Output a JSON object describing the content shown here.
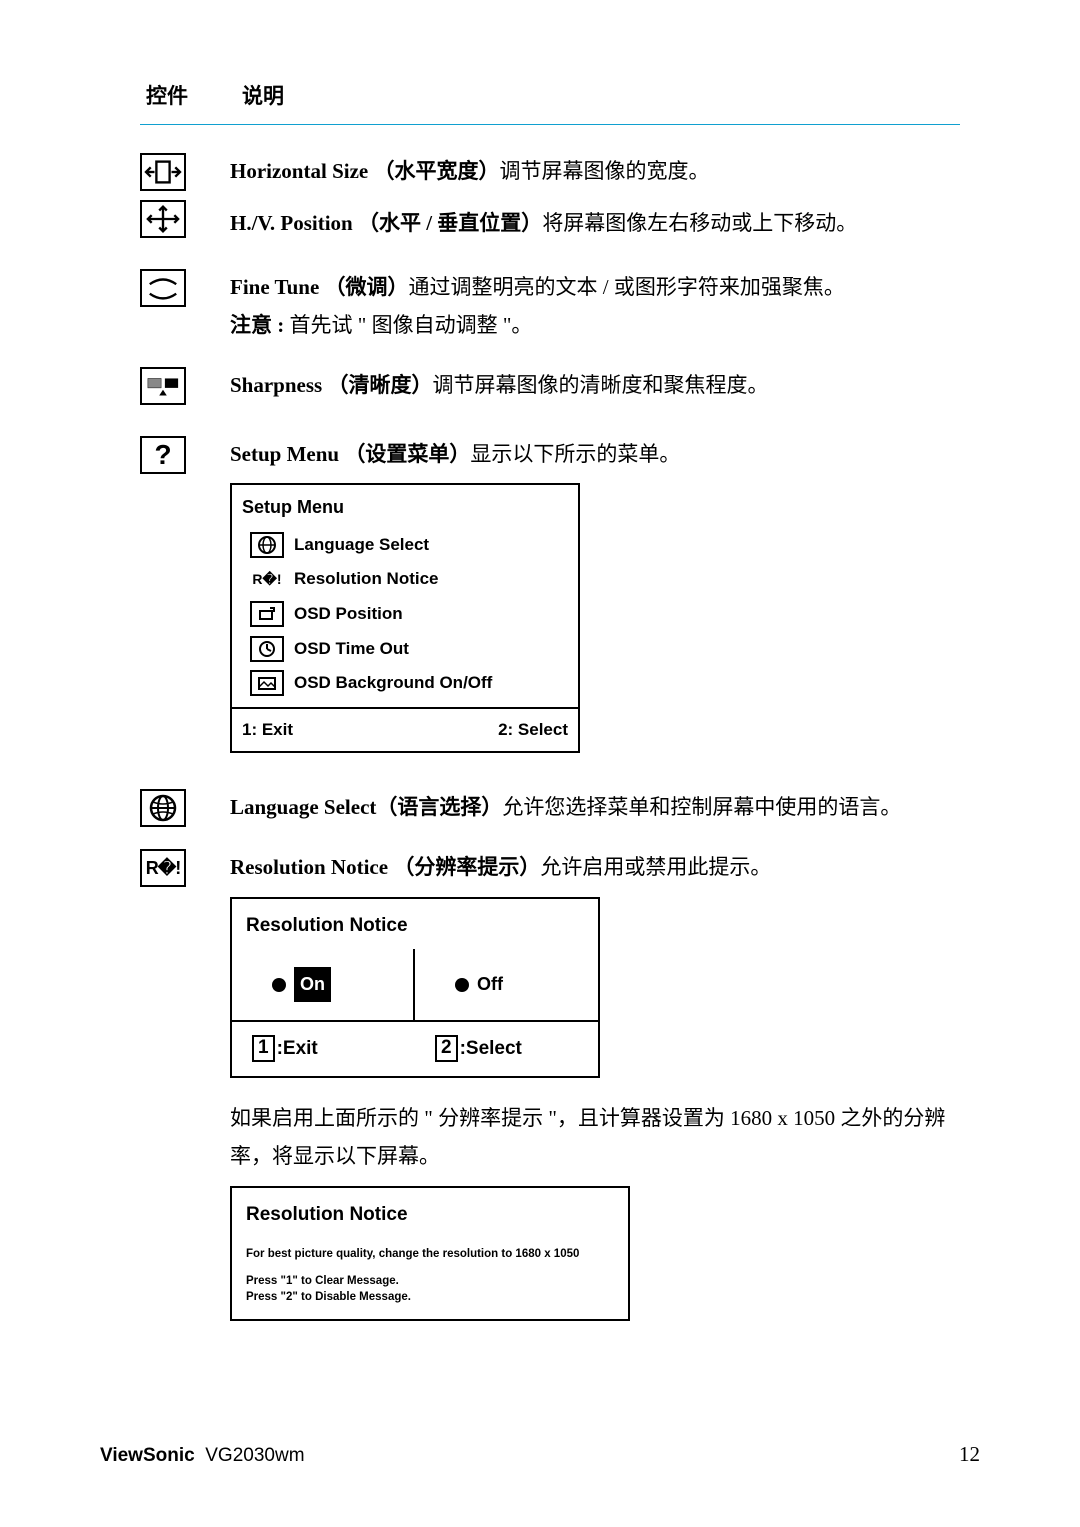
{
  "header": {
    "col1": "控件",
    "col2": "说明"
  },
  "horiz": {
    "title": "Horizontal Size ",
    "cn": "（水平宽度）",
    "desc": "调节屏幕图像的宽度。"
  },
  "hvpos": {
    "title": "H./V. Position ",
    "cn": "（水平 / 垂直位置）",
    "desc": "将屏幕图像左右移动或上下移动。"
  },
  "fine": {
    "title": "Fine Tune ",
    "cn": "（微调）",
    "desc": "通过调整明亮的文本 / 或图形字符来加强聚焦。",
    "note_label": "注意 : ",
    "note_text": "首先试 \" 图像自动调整 \"。"
  },
  "sharp": {
    "title": "Sharpness ",
    "cn": "（清晰度）",
    "desc": "调节屏幕图像的清晰度和聚焦程度。"
  },
  "setup": {
    "title": "Setup Menu ",
    "cn": "（设置菜单）",
    "desc": "显示以下所示的菜单。",
    "box_title": "Setup Menu",
    "items": {
      "lang": "Language Select",
      "res": "Resolution Notice",
      "osdpos": "OSD Position",
      "osdtime": "OSD Time Out",
      "osdbg": "OSD Background On/Off"
    },
    "exit": "1: Exit",
    "select": "2: Select"
  },
  "lang": {
    "title": "Language Select",
    "cn": "（语言选择）",
    "desc": "允许您选择菜单和控制屏幕中使用的语言。"
  },
  "resnotice": {
    "title": "Resolution Notice ",
    "cn": "（分辨率提示）",
    "desc": "允许启用或禁用此提示。",
    "box1": {
      "title": "Resolution Notice",
      "on": "On",
      "off": "Off",
      "exit": ":Exit",
      "select": ":Select",
      "key1": "1",
      "key2": "2"
    },
    "para": "如果启用上面所示的 \" 分辨率提示 \"，且计算器设置为 1680 x 1050 之外的分辨率，将显示以下屏幕。",
    "box2": {
      "title": "Resolution Notice",
      "line1": "For best picture quality, change the resolution to 1680 x 1050",
      "line2a": "Press \"1\" to Clear Message.",
      "line2b": "Press \"2\" to Disable Message."
    }
  },
  "footer": {
    "brand": "ViewSonic",
    "model": "VG2030wm",
    "page": "12"
  }
}
